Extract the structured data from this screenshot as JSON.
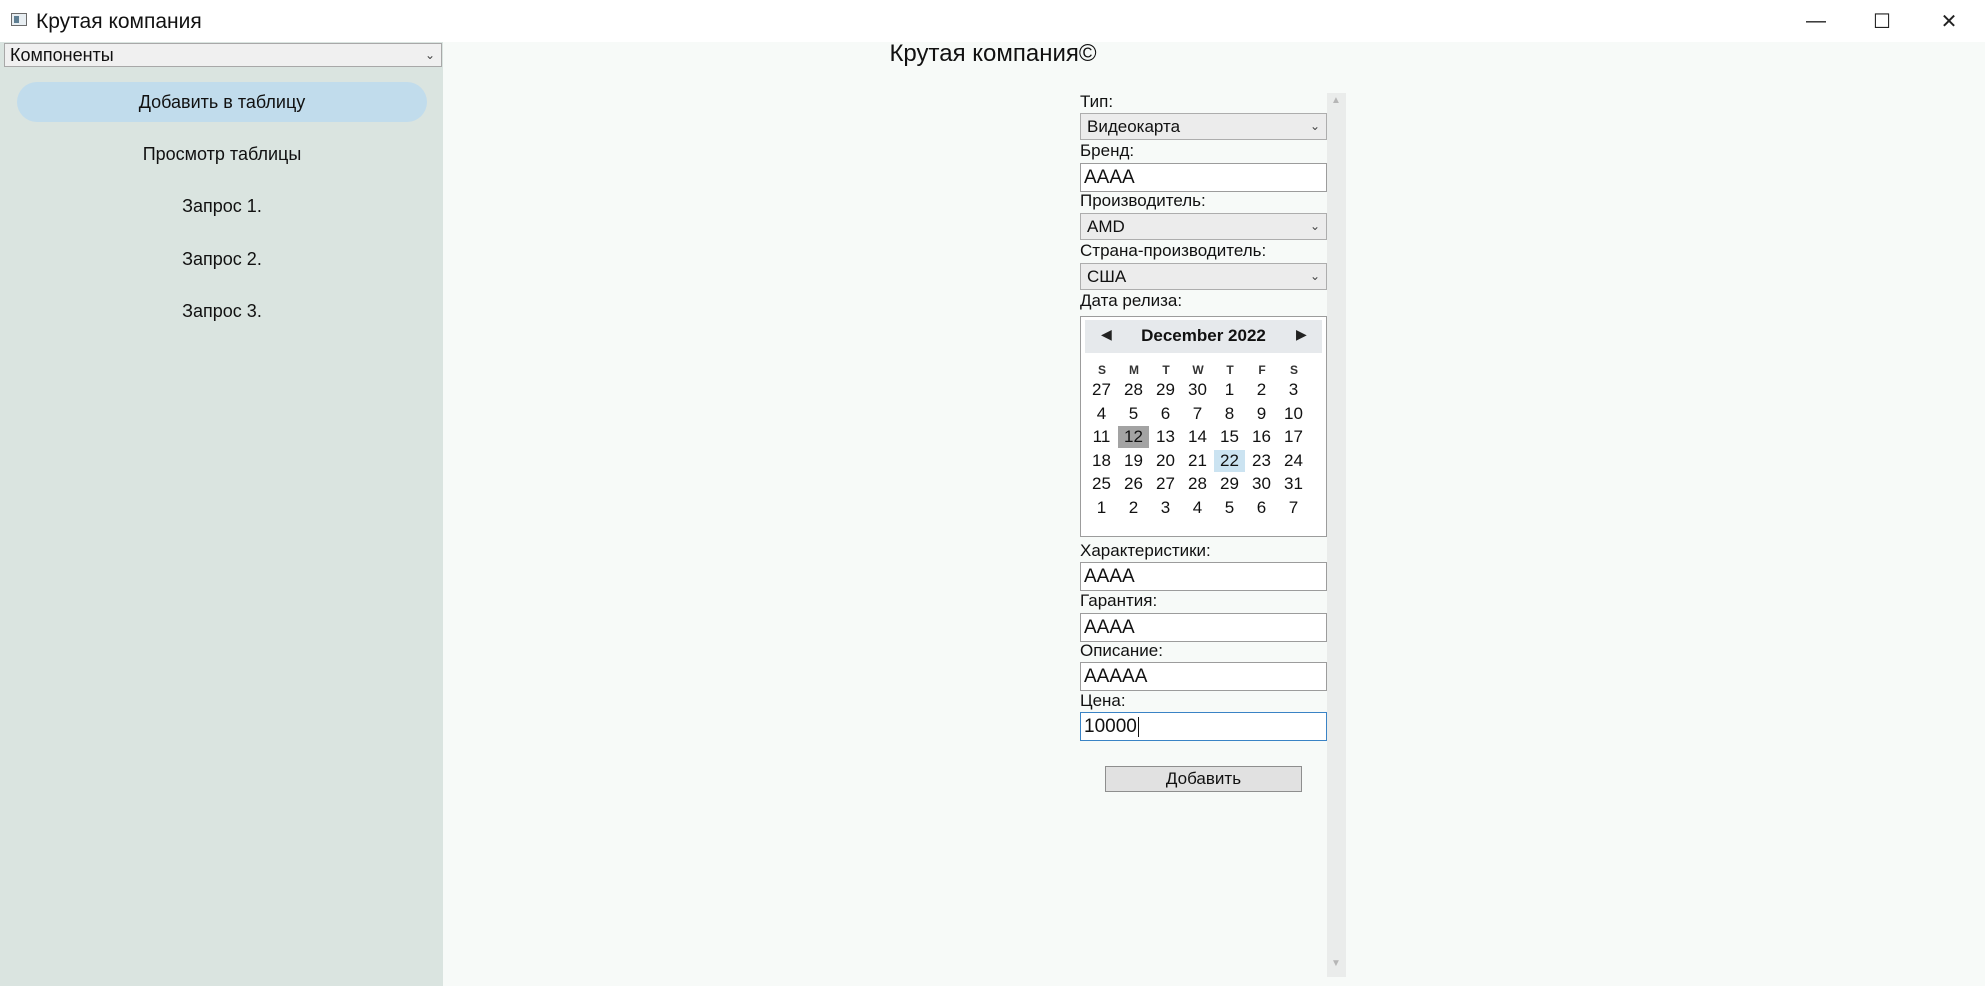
{
  "window": {
    "title": "Крутая компания",
    "minimize_glyph": "—",
    "maximize_glyph": "☐",
    "close_glyph": "✕"
  },
  "sidebar": {
    "selector": {
      "value": "Компоненты",
      "chevron": "⌄"
    },
    "items": [
      {
        "label": "Добавить в таблицу",
        "active": true
      },
      {
        "label": "Просмотр таблицы",
        "active": false
      },
      {
        "label": "Запрос 1.",
        "active": false
      },
      {
        "label": "Запрос 2.",
        "active": false
      },
      {
        "label": "Запрос 3.",
        "active": false
      }
    ]
  },
  "main": {
    "title": "Крутая компания©"
  },
  "form": {
    "type": {
      "label": "Тип:",
      "value": "Видеокарта"
    },
    "brand": {
      "label": "Бренд:",
      "value": "AAAA"
    },
    "manufacturer": {
      "label": "Производитель:",
      "value": "AMD"
    },
    "country": {
      "label": "Страна-производитель:",
      "value": "США"
    },
    "release_date": {
      "label": "Дата релиза:"
    },
    "specs": {
      "label": "Характеристики:",
      "value": "AAAA"
    },
    "warranty": {
      "label": "Гарантия:",
      "value": "AAAA"
    },
    "description": {
      "label": "Описание:",
      "value": "AAAAA"
    },
    "price": {
      "label": "Цена:",
      "value": "10000"
    },
    "submit_label": "Добавить",
    "combo_chevron": "⌄"
  },
  "calendar": {
    "title": "December 2022",
    "prev_glyph": "◀",
    "next_glyph": "▶",
    "weekdays": [
      "S",
      "M",
      "T",
      "W",
      "T",
      "F",
      "S"
    ],
    "weeks": [
      [
        "27",
        "28",
        "29",
        "30",
        "1",
        "2",
        "3"
      ],
      [
        "4",
        "5",
        "6",
        "7",
        "8",
        "9",
        "10"
      ],
      [
        "11",
        "12",
        "13",
        "14",
        "15",
        "16",
        "17"
      ],
      [
        "18",
        "19",
        "20",
        "21",
        "22",
        "23",
        "24"
      ],
      [
        "25",
        "26",
        "27",
        "28",
        "29",
        "30",
        "31"
      ],
      [
        "1",
        "2",
        "3",
        "4",
        "5",
        "6",
        "7"
      ]
    ],
    "selected_day": "12",
    "today_day": "22"
  },
  "scrollbar": {
    "up_glyph": "▲",
    "down_glyph": "▼"
  }
}
